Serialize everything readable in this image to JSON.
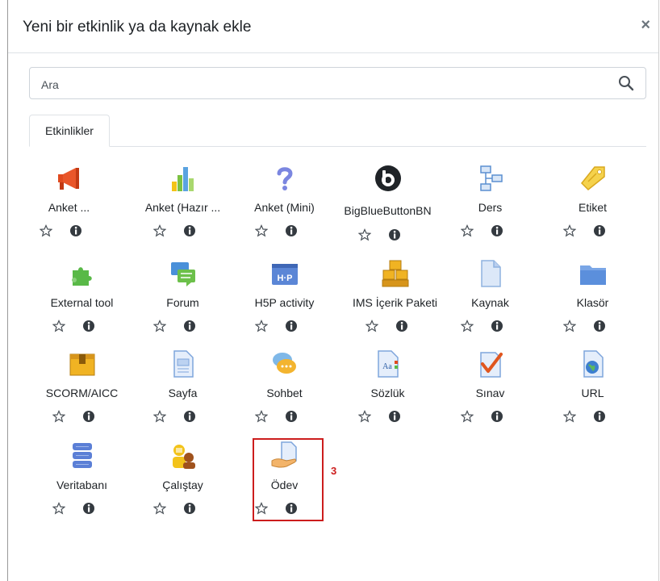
{
  "dialog": {
    "title": "Yeni bir etkinlik ya da kaynak ekle",
    "close": "×"
  },
  "search": {
    "placeholder": "Ara"
  },
  "tabs": [
    {
      "label": "Etkinlikler"
    }
  ],
  "items": [
    {
      "label": "Anket ...",
      "icon": "megaphone-icon"
    },
    {
      "label": "Anket (Hazır ...",
      "icon": "bar-chart-icon"
    },
    {
      "label": "Anket (Mini)",
      "icon": "question-mark-icon"
    },
    {
      "label": "BigBlueButtonBN",
      "icon": "bigbluebutton-icon"
    },
    {
      "label": "Ders",
      "icon": "lesson-icon"
    },
    {
      "label": "Etiket",
      "icon": "tag-icon"
    },
    {
      "label": "External tool",
      "icon": "puzzle-icon"
    },
    {
      "label": "Forum",
      "icon": "forum-icon"
    },
    {
      "label": "H5P activity",
      "icon": "h5p-icon"
    },
    {
      "label": "IMS İçerik Paketi",
      "icon": "ims-package-icon"
    },
    {
      "label": "Kaynak",
      "icon": "file-icon"
    },
    {
      "label": "Klasör",
      "icon": "folder-icon"
    },
    {
      "label": "SCORM/AICC",
      "icon": "scorm-icon"
    },
    {
      "label": "Sayfa",
      "icon": "page-icon"
    },
    {
      "label": "Sohbet",
      "icon": "chat-icon"
    },
    {
      "label": "Sözlük",
      "icon": "glossary-icon"
    },
    {
      "label": "Sınav",
      "icon": "quiz-icon"
    },
    {
      "label": "URL",
      "icon": "url-icon"
    },
    {
      "label": "Veritabanı",
      "icon": "database-icon"
    },
    {
      "label": "Çalıştay",
      "icon": "workshop-icon"
    },
    {
      "label": "Ödev",
      "icon": "assignment-icon"
    }
  ],
  "annotation": {
    "number": "3",
    "color": "#cc1d1d"
  },
  "colors": {
    "star": "#495057",
    "info": "#343a40",
    "border": "#dee2e6"
  }
}
